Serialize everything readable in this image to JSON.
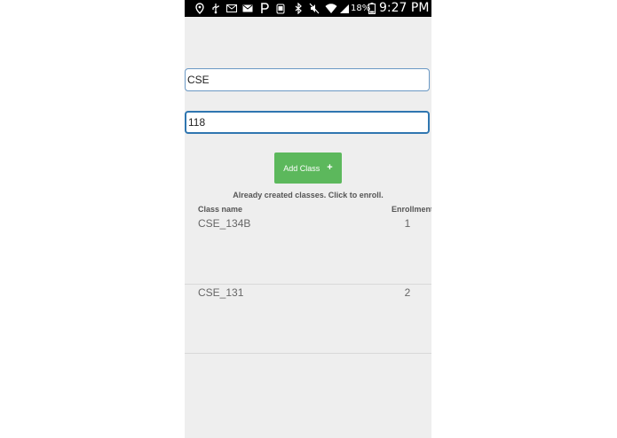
{
  "status_bar": {
    "battery_text": "18%",
    "time": "9:27 PM",
    "icons": [
      "location-icon",
      "usb-icon",
      "gmail-icon",
      "gmail-icon",
      "pandora-icon",
      "phone-icon",
      "bluetooth-icon",
      "mute-icon",
      "wifi-icon",
      "signal-icon",
      "battery-icon"
    ]
  },
  "form": {
    "department_value": "CSE",
    "number_value": "118",
    "add_button_label": "Add Class",
    "add_button_icon": "+"
  },
  "classes": {
    "hint": "Already created classes. Click to enroll.",
    "headers": {
      "class_name": "Class name",
      "enrollment": "Enrollment"
    },
    "rows": [
      {
        "name": "CSE_134B",
        "enrollment": "1"
      },
      {
        "name": "CSE_131",
        "enrollment": "2"
      }
    ]
  },
  "colors": {
    "accent_green": "#5cb85c",
    "field_border": "#2f76b0",
    "background": "#eeeeee"
  }
}
